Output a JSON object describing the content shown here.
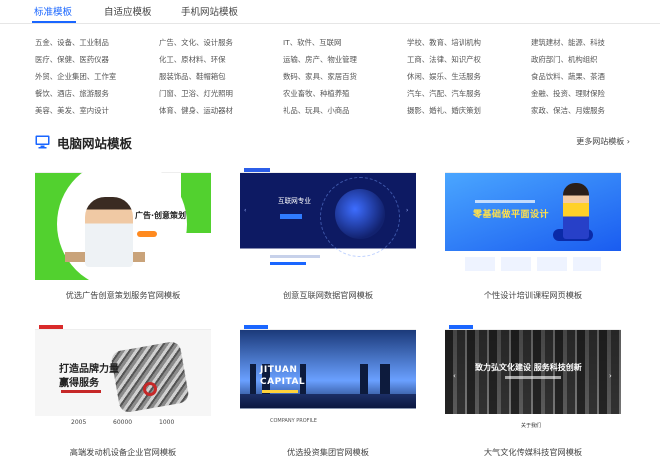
{
  "tabs": [
    {
      "label": "标准模板",
      "active": true
    },
    {
      "label": "自适应模板",
      "active": false
    },
    {
      "label": "手机网站模板",
      "active": false
    }
  ],
  "categories": [
    [
      "五金、设备、工业制品",
      "广告、文化、设计服务",
      "IT、软件、互联网",
      "学校、教育、培训机构",
      "建筑建材、能源、科技"
    ],
    [
      "医疗、保健、医药仪器",
      "化工、原材料、环保",
      "运输、房产、物业管理",
      "工商、法律、知识产权",
      "政府部门、机构组织"
    ],
    [
      "外贸、企业集团、工作室",
      "服装饰品、鞋帽箱包",
      "数码、家具、家居百货",
      "休闲、娱乐、生活服务",
      "食品饮料、蔬果、茶酒"
    ],
    [
      "餐饮、酒店、旅游服务",
      "门窗、卫浴、灯光照明",
      "农业畜牧、种植养殖",
      "汽车、汽配、汽车服务",
      "金融、投资、理财保险"
    ],
    [
      "美容、美发、室内设计",
      "体育、健身、运动器材",
      "礼品、玩具、小商品",
      "摄影、婚礼、婚庆策划",
      "家政、保洁、月嫂服务"
    ]
  ],
  "section": {
    "title": "电脑网站模板",
    "more": "更多网站模板 ›",
    "icon": "monitor-icon"
  },
  "templates": [
    {
      "caption": "优选广告创意策划服务官网模板",
      "thumb_text": "广告·创意策划"
    },
    {
      "caption": "创意互联网数据官网模板",
      "thumb_text": "互联网专业"
    },
    {
      "caption": "个性设计培训课程网页模板",
      "thumb_text": "零基础做平面设计"
    },
    {
      "caption": "高端发动机设备企业官网模板",
      "thumb_text": "打造品牌力量",
      "thumb_text2": "赢得服务",
      "stats": [
        "2005",
        "60000",
        "1000"
      ]
    },
    {
      "caption": "优选投资集团官网模板",
      "thumb_text": "JITUAN",
      "thumb_text2": "CAPITAL",
      "thumb_foot": "COMPANY PROFILE"
    },
    {
      "caption": "大气文化传媒科技官网模板",
      "thumb_text": "致力弘文化建设  服务科技创新",
      "thumb_about": "关于我们"
    }
  ],
  "colors": {
    "accent": "#1a66ff",
    "green": "#52d12f",
    "navy": "#0d1a63"
  }
}
